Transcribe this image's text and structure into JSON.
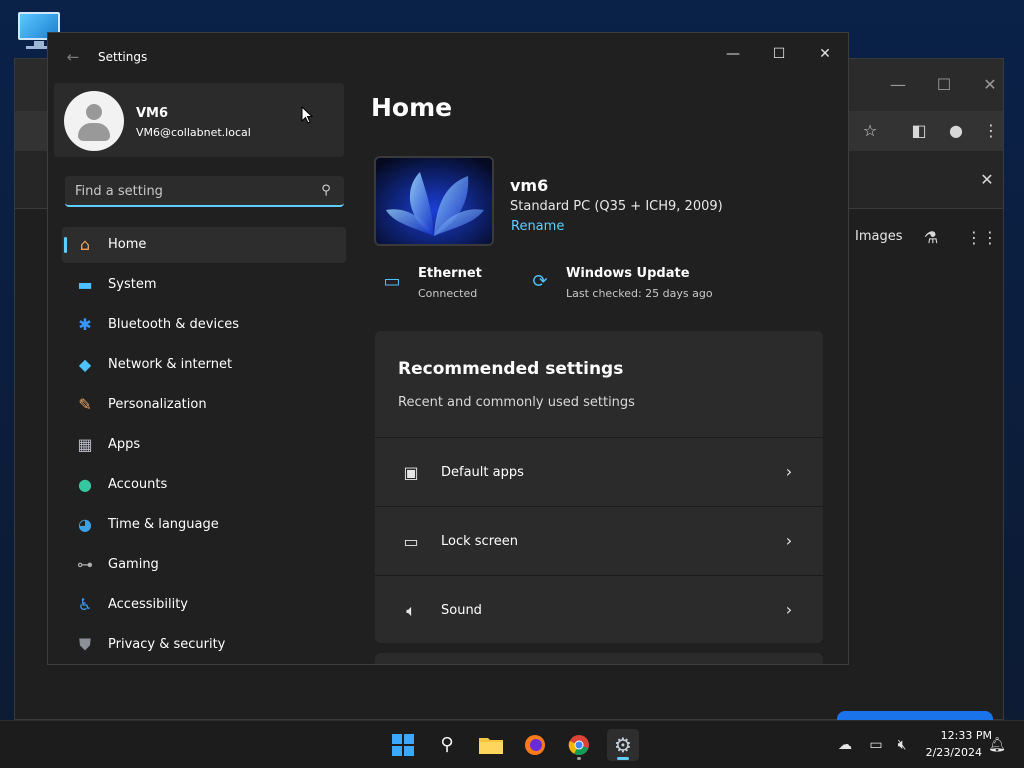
{
  "window": {
    "title": "Settings",
    "controls": {
      "minimize": "—",
      "maximize": "☐",
      "close": "✕"
    }
  },
  "user": {
    "name": "VM6",
    "email": "VM6@collabnet.local"
  },
  "search": {
    "placeholder": "Find a setting"
  },
  "sidebar": {
    "items": [
      {
        "label": "Home",
        "icon": "home-icon",
        "active": true
      },
      {
        "label": "System",
        "icon": "system-icon"
      },
      {
        "label": "Bluetooth & devices",
        "icon": "bluetooth-icon"
      },
      {
        "label": "Network & internet",
        "icon": "wifi-icon"
      },
      {
        "label": "Personalization",
        "icon": "brush-icon"
      },
      {
        "label": "Apps",
        "icon": "apps-icon"
      },
      {
        "label": "Accounts",
        "icon": "accounts-icon"
      },
      {
        "label": "Time & language",
        "icon": "globe-clock-icon"
      },
      {
        "label": "Gaming",
        "icon": "gamepad-icon"
      },
      {
        "label": "Accessibility",
        "icon": "accessibility-icon"
      },
      {
        "label": "Privacy & security",
        "icon": "shield-icon"
      }
    ]
  },
  "main": {
    "title": "Home",
    "device": {
      "name": "vm6",
      "description": "Standard PC (Q35 + ICH9, 2009)",
      "rename": "Rename"
    },
    "status": {
      "ethernet": {
        "title": "Ethernet",
        "sub": "Connected"
      },
      "update": {
        "title": "Windows Update",
        "sub": "Last checked: 25 days ago"
      }
    },
    "recommended": {
      "title": "Recommended settings",
      "subtitle": "Recent and commonly used settings",
      "items": [
        {
          "label": "Default apps",
          "icon": "default-apps-icon"
        },
        {
          "label": "Lock screen",
          "icon": "lock-screen-icon"
        },
        {
          "label": "Sound",
          "icon": "speaker-icon"
        }
      ]
    }
  },
  "background_browser": {
    "images_link": "Images"
  },
  "taskbar": {
    "time": "12:33 PM",
    "date": "2/23/2024"
  },
  "colors": {
    "accent": "#60cdff",
    "window_bg": "#202020",
    "card_bg": "#2b2b2b"
  }
}
